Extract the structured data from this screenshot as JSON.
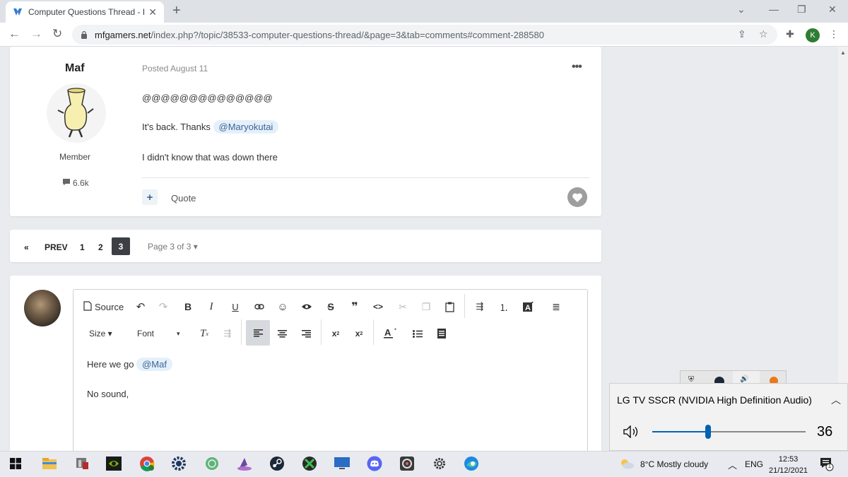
{
  "browser": {
    "tab_title": "Computer Questions Thread - Pa",
    "url_host": "mfgamers.net",
    "url_path": "/index.php?/topic/38533-computer-questions-thread/&page=3&tab=comments#comment-288580",
    "profile_initial": "K"
  },
  "post": {
    "author": "Maf",
    "posted": "Posted August 11",
    "role": "Member",
    "reputation": "6.6k",
    "lines": {
      "line1": "@@@@@@@@@@@@@@",
      "line2_text": "It's back. Thanks",
      "line2_mention": "@Maryokutai",
      "line3": "I didn't know that was down there"
    },
    "quote_label": "Quote"
  },
  "pagination": {
    "first_symbol": "«",
    "prev_label": "PREV",
    "pages": [
      "1",
      "2",
      "3"
    ],
    "current_page": "3",
    "page_of_label": "Page 3 of 3 ▾"
  },
  "editor": {
    "source_label": "Source",
    "size_label": "Size ▾",
    "font_label": "Font",
    "font_caret": "▾",
    "line1_text": "Here we go",
    "line1_mention": "@Maf",
    "line2": "No sound,"
  },
  "volume": {
    "device": "LG TV SSCR (NVIDIA High Definition Audio)",
    "level": "36",
    "level_fraction": 0.36
  },
  "taskbar": {
    "weather": "8°C  Mostly cloudy",
    "lang": "ENG",
    "time": "12:53",
    "date": "21/12/2021",
    "notif_count": "1"
  },
  "colors": {
    "accent": "#3d6594",
    "mention_bg": "#e4f0fb",
    "volume_blue": "#0063b1"
  }
}
